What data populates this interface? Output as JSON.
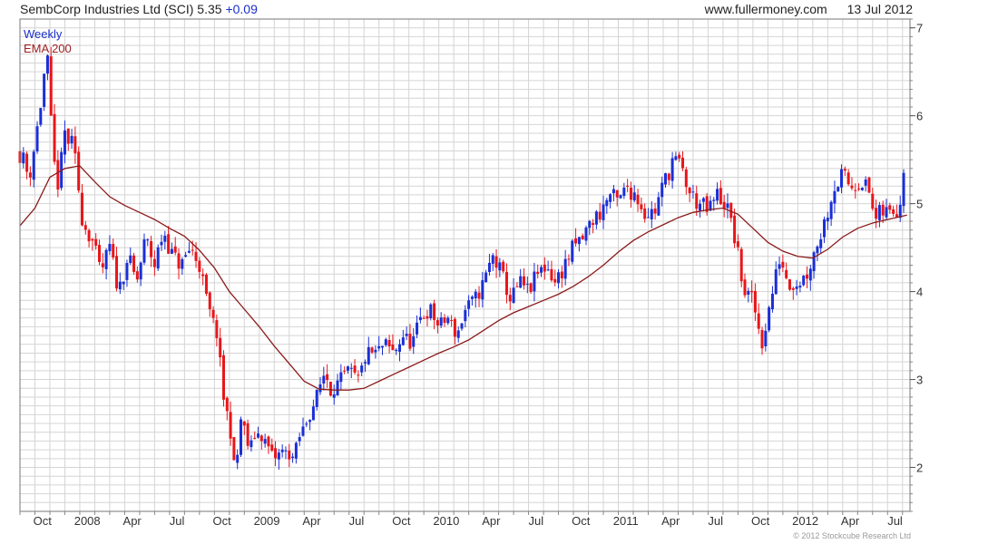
{
  "header": {
    "title": "SembCorp Industries Ltd (SCI) 5.35",
    "change": "+0.09",
    "source": "www.fullermoney.com",
    "date": "13 Jul 2012"
  },
  "footer": {
    "copyright": "© 2012 Stockcube Research Ltd"
  },
  "colors": {
    "up": "#1a2fd6",
    "down": "#e8161a",
    "ema": "#8b1a1a",
    "grid": "#d4d4d4"
  },
  "chart_data": {
    "type": "candlestick",
    "legend": [
      {
        "label": "Weekly",
        "color": "#1a2fcc"
      },
      {
        "label": "EMA 200",
        "color": "#a02020"
      }
    ],
    "legend_position": "top-left",
    "y_axis_side": "right",
    "grid": true,
    "ylim": [
      1.5,
      7.1
    ],
    "y_ticks": [
      2,
      3,
      4,
      5,
      6,
      7
    ],
    "x_range_months": [
      0,
      59.5
    ],
    "x_ticks": [
      {
        "label": "Oct",
        "m": 1.5
      },
      {
        "label": "2008",
        "m": 4.5
      },
      {
        "label": "Apr",
        "m": 7.5
      },
      {
        "label": "Jul",
        "m": 10.5
      },
      {
        "label": "Oct",
        "m": 13.5
      },
      {
        "label": "2009",
        "m": 16.5
      },
      {
        "label": "Apr",
        "m": 19.5
      },
      {
        "label": "Jul",
        "m": 22.5
      },
      {
        "label": "Oct",
        "m": 25.5
      },
      {
        "label": "2010",
        "m": 28.5
      },
      {
        "label": "Apr",
        "m": 31.5
      },
      {
        "label": "Jul",
        "m": 34.5
      },
      {
        "label": "Oct",
        "m": 37.5
      },
      {
        "label": "2011",
        "m": 40.5
      },
      {
        "label": "Apr",
        "m": 43.5
      },
      {
        "label": "Jul",
        "m": 46.5
      },
      {
        "label": "Oct",
        "m": 49.5
      },
      {
        "label": "2012",
        "m": 52.5
      },
      {
        "label": "Apr",
        "m": 55.5
      },
      {
        "label": "Jul",
        "m": 58.5
      }
    ],
    "close_path": [
      [
        0,
        5.6
      ],
      [
        0.6,
        5.3
      ],
      [
        1.2,
        5.9
      ],
      [
        1.8,
        6.7
      ],
      [
        2.2,
        5.5
      ],
      [
        2.6,
        5.2
      ],
      [
        3.0,
        5.8
      ],
      [
        3.6,
        5.6
      ],
      [
        4.2,
        4.8
      ],
      [
        4.8,
        4.6
      ],
      [
        5.4,
        4.2
      ],
      [
        6.0,
        4.5
      ],
      [
        6.6,
        4.0
      ],
      [
        7.2,
        4.4
      ],
      [
        7.8,
        4.1
      ],
      [
        8.4,
        4.6
      ],
      [
        9.0,
        4.3
      ],
      [
        9.6,
        4.7
      ],
      [
        10.2,
        4.4
      ],
      [
        10.8,
        4.3
      ],
      [
        11.4,
        4.5
      ],
      [
        12.0,
        4.3
      ],
      [
        12.6,
        3.8
      ],
      [
        13.2,
        3.5
      ],
      [
        13.6,
        2.8
      ],
      [
        14.0,
        2.5
      ],
      [
        14.4,
        1.9
      ],
      [
        14.8,
        2.6
      ],
      [
        15.3,
        2.2
      ],
      [
        15.8,
        2.4
      ],
      [
        16.4,
        2.3
      ],
      [
        17.0,
        2.1
      ],
      [
        17.6,
        2.2
      ],
      [
        18.2,
        2.1
      ],
      [
        18.8,
        2.4
      ],
      [
        19.4,
        2.6
      ],
      [
        20.0,
        2.9
      ],
      [
        20.4,
        3.1
      ],
      [
        20.8,
        2.85
      ],
      [
        21.4,
        3.0
      ],
      [
        22.0,
        3.1
      ],
      [
        22.6,
        3.0
      ],
      [
        23.2,
        3.3
      ],
      [
        23.8,
        3.3
      ],
      [
        24.4,
        3.4
      ],
      [
        25.0,
        3.3
      ],
      [
        25.6,
        3.5
      ],
      [
        26.2,
        3.4
      ],
      [
        26.8,
        3.7
      ],
      [
        27.4,
        3.8
      ],
      [
        28.0,
        3.6
      ],
      [
        28.6,
        3.7
      ],
      [
        29.2,
        3.5
      ],
      [
        29.8,
        3.8
      ],
      [
        30.4,
        3.9
      ],
      [
        31.0,
        4.1
      ],
      [
        31.6,
        4.4
      ],
      [
        32.2,
        4.2
      ],
      [
        32.8,
        3.9
      ],
      [
        33.4,
        4.1
      ],
      [
        34.0,
        4.0
      ],
      [
        34.6,
        4.2
      ],
      [
        35.2,
        4.3
      ],
      [
        35.8,
        4.1
      ],
      [
        36.4,
        4.3
      ],
      [
        37.0,
        4.5
      ],
      [
        37.6,
        4.6
      ],
      [
        38.2,
        4.8
      ],
      [
        38.8,
        4.9
      ],
      [
        39.4,
        5.1
      ],
      [
        40.0,
        5.0
      ],
      [
        40.6,
        5.2
      ],
      [
        41.2,
        5.1
      ],
      [
        41.8,
        4.9
      ],
      [
        42.4,
        4.9
      ],
      [
        43.0,
        5.2
      ],
      [
        43.6,
        5.5
      ],
      [
        44.2,
        5.4
      ],
      [
        44.8,
        5.1
      ],
      [
        45.4,
        5.0
      ],
      [
        46.0,
        4.9
      ],
      [
        46.6,
        5.1
      ],
      [
        47.2,
        5.0
      ],
      [
        47.8,
        4.6
      ],
      [
        48.4,
        4.0
      ],
      [
        49.0,
        3.9
      ],
      [
        49.6,
        3.4
      ],
      [
        50.2,
        3.9
      ],
      [
        50.8,
        4.4
      ],
      [
        51.4,
        4.1
      ],
      [
        52.0,
        4.1
      ],
      [
        52.6,
        4.2
      ],
      [
        53.2,
        4.5
      ],
      [
        53.8,
        4.8
      ],
      [
        54.4,
        5.2
      ],
      [
        55.0,
        5.3
      ],
      [
        55.6,
        5.2
      ],
      [
        56.2,
        5.3
      ],
      [
        56.8,
        5.1
      ],
      [
        57.2,
        4.8
      ],
      [
        57.6,
        4.9
      ],
      [
        58.2,
        4.9
      ],
      [
        58.8,
        5.0
      ],
      [
        59.3,
        5.35
      ]
    ],
    "ema_path": [
      [
        0,
        4.75
      ],
      [
        1,
        4.95
      ],
      [
        2,
        5.3
      ],
      [
        3,
        5.4
      ],
      [
        4,
        5.43
      ],
      [
        5,
        5.25
      ],
      [
        6,
        5.08
      ],
      [
        7,
        4.98
      ],
      [
        8,
        4.9
      ],
      [
        9,
        4.82
      ],
      [
        10,
        4.72
      ],
      [
        11,
        4.63
      ],
      [
        12,
        4.47
      ],
      [
        13,
        4.27
      ],
      [
        14,
        4.0
      ],
      [
        15,
        3.8
      ],
      [
        16,
        3.6
      ],
      [
        17,
        3.38
      ],
      [
        18,
        3.18
      ],
      [
        19,
        2.98
      ],
      [
        20,
        2.89
      ],
      [
        21,
        2.88
      ],
      [
        22,
        2.88
      ],
      [
        23,
        2.9
      ],
      [
        24,
        2.98
      ],
      [
        25,
        3.06
      ],
      [
        26,
        3.14
      ],
      [
        27,
        3.22
      ],
      [
        28,
        3.3
      ],
      [
        29,
        3.37
      ],
      [
        30,
        3.45
      ],
      [
        31,
        3.56
      ],
      [
        32,
        3.67
      ],
      [
        33,
        3.76
      ],
      [
        34,
        3.83
      ],
      [
        35,
        3.9
      ],
      [
        36,
        3.97
      ],
      [
        37,
        4.06
      ],
      [
        38,
        4.17
      ],
      [
        39,
        4.3
      ],
      [
        40,
        4.45
      ],
      [
        41,
        4.58
      ],
      [
        42,
        4.68
      ],
      [
        43,
        4.76
      ],
      [
        44,
        4.84
      ],
      [
        45,
        4.9
      ],
      [
        46,
        4.93
      ],
      [
        47,
        4.95
      ],
      [
        48,
        4.88
      ],
      [
        49,
        4.72
      ],
      [
        50,
        4.56
      ],
      [
        51,
        4.46
      ],
      [
        52,
        4.4
      ],
      [
        53,
        4.38
      ],
      [
        54,
        4.48
      ],
      [
        55,
        4.62
      ],
      [
        56,
        4.72
      ],
      [
        57,
        4.78
      ],
      [
        58,
        4.82
      ],
      [
        59.3,
        4.87
      ]
    ]
  }
}
